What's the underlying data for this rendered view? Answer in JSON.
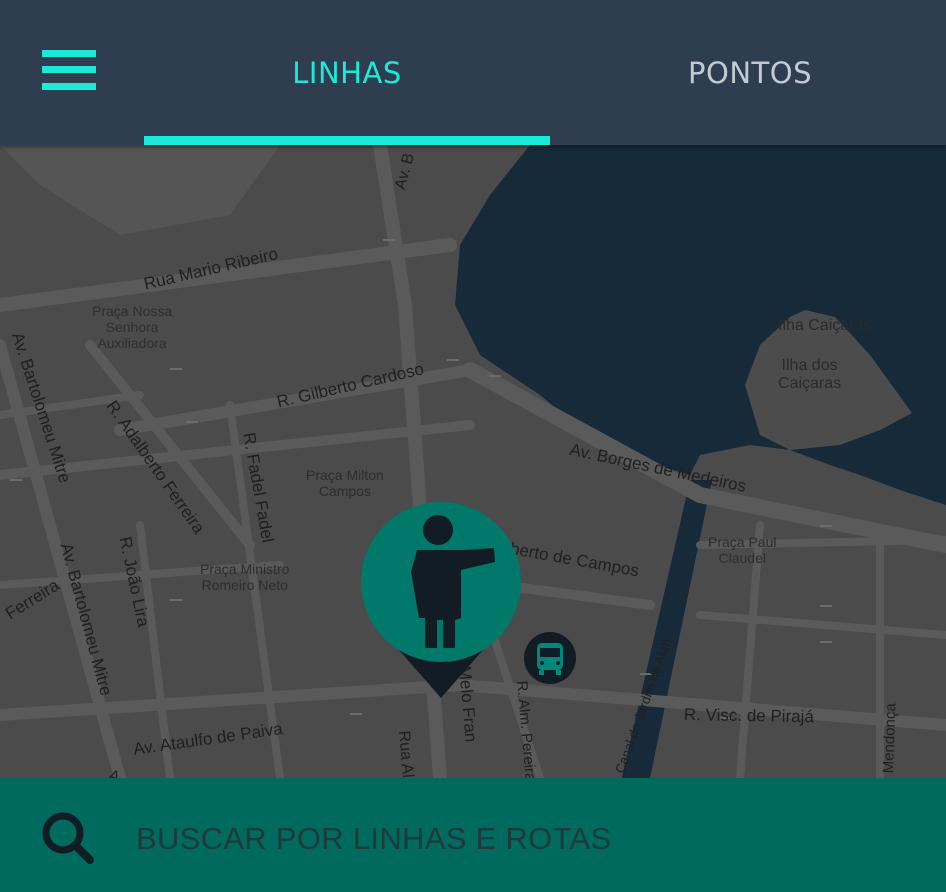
{
  "header": {
    "tabs": [
      {
        "label": "LINHAS",
        "active": true
      },
      {
        "label": "PONTOS",
        "active": false
      }
    ],
    "accent_color": "#1de9d8",
    "background_color": "#2e3e50"
  },
  "map": {
    "streets": [
      "Rua Mario Ribeiro",
      "R. Gilberto Cardoso",
      "Av. Borges de Medeiros",
      "R. Adalberto Ferreira",
      "R. Fadel Fadel",
      "Av. Bartolomeu Mitre",
      "Av. Bartolomeu Mitre",
      "R. João Lira",
      "Ferreira",
      "Av. Ataulfo de Paiva",
      "berto de Campos",
      "R. Visc. de Pirajá",
      "Canal do Jardim de Alah",
      "R. Alm. Pereira",
      "Melo Fran",
      "Rua Al",
      "Mendonça",
      "Av. B",
      "A"
    ],
    "places": [
      "Praça Nossa\nSenhora\nAuxiliadora",
      "Praça Milton\nCampos",
      "Praça Ministro\nRomeiro Neto",
      "Praça Paul\nClaudel",
      "Ilha Caiçaras",
      "Ilha dos\nCaiçaras"
    ],
    "markers": {
      "user": "person-pointing-icon",
      "stop": "bus-icon"
    }
  },
  "search": {
    "placeholder": "BUSCAR POR LINHAS E ROTAS",
    "background_color": "#006a5e"
  }
}
